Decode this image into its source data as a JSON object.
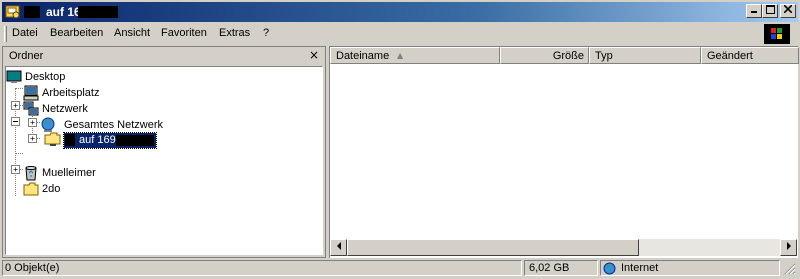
{
  "window": {
    "title": "auf 169.",
    "controls": [
      "minimize",
      "maximize",
      "close"
    ]
  },
  "menu": [
    {
      "label": "Datei"
    },
    {
      "label": "Bearbeiten"
    },
    {
      "label": "Ansicht"
    },
    {
      "label": "Favoriten"
    },
    {
      "label": "Extras"
    },
    {
      "label": "?"
    }
  ],
  "folders_pane": {
    "title": "Ordner",
    "close_symbol": "×",
    "tree": [
      {
        "label": "Desktop",
        "icon": "desktop-icon",
        "expander": ""
      },
      {
        "label": "Arbeitsplatz",
        "icon": "my-computer-icon",
        "expander": "+"
      },
      {
        "label": "Netzwerk",
        "icon": "network-icon",
        "expander": "−"
      },
      {
        "label": "Gesamtes Netzwerk",
        "icon": "globe-icon",
        "expander": "+"
      },
      {
        "label": "auf 169.",
        "icon": "network-folder-icon",
        "expander": "+",
        "selected": true
      },
      {
        "label": "Muelleimer",
        "icon": "recycle-bin-icon",
        "expander": ""
      },
      {
        "label": "2do",
        "icon": "folder-icon",
        "expander": "+"
      }
    ]
  },
  "file_list": {
    "columns": [
      {
        "label": "Dateiname",
        "align": "left",
        "sorted": true
      },
      {
        "label": "Größe",
        "align": "right"
      },
      {
        "label": "Typ",
        "align": "left"
      },
      {
        "label": "Geändert",
        "align": "left"
      }
    ],
    "rows": []
  },
  "status_bar": {
    "objects": "0 Objekt(e)",
    "size": "6,02 GB",
    "zone": "Internet"
  },
  "colors": {
    "titlebar_start": "#0a246a",
    "titlebar_end": "#a6caf0",
    "face": "#d4d0c8",
    "selection": "#0a246a"
  }
}
